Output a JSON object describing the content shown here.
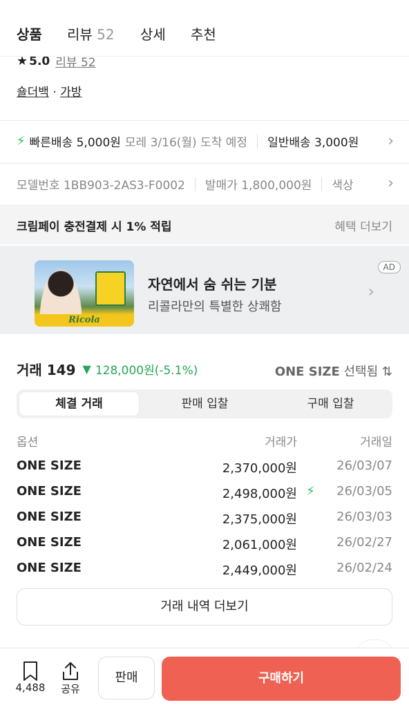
{
  "tabs": [
    {
      "label": "상품",
      "count": ""
    },
    {
      "label": "리뷰",
      "count": "52"
    },
    {
      "label": "상세",
      "count": ""
    },
    {
      "label": "추천",
      "count": ""
    }
  ],
  "rating": {
    "score": "5.0",
    "review_link": "리뷰 52"
  },
  "breadcrumb": {
    "cat1": "숄더백",
    "sep": "·",
    "cat2": "가방"
  },
  "shipping": {
    "fast_label": "빠른배송 5,000원",
    "fast_date": "모레 3/16(월) 도착 예정",
    "normal_label": "일반배송 3,000원"
  },
  "info": {
    "model": "모델번호 1BB903-2AS3-F0002",
    "release_price": "발매가 1,800,000원",
    "color": "색상"
  },
  "point": {
    "text": "크림페이 충전결제 시 1% 적립",
    "more": "혜택 더보기"
  },
  "ad": {
    "brand": "Ricola",
    "title": "자연에서 숨 쉬는 기분",
    "subtitle": "리콜라만의 특별한 상쾌함",
    "badge": "AD"
  },
  "trade": {
    "label": "거래 149",
    "change": "128,000원(-5.1%)",
    "size_value": "ONE SIZE",
    "size_suffix": "선택됨"
  },
  "segments": [
    "체결 거래",
    "판매 입찰",
    "구매 입찰"
  ],
  "table": {
    "headers": [
      "옵션",
      "거래가",
      "거래일"
    ],
    "rows": [
      {
        "option": "ONE SIZE",
        "price": "2,370,000원",
        "date": "26/03/07"
      },
      {
        "option": "ONE SIZE",
        "price": "2,498,000원",
        "date": "26/03/05"
      },
      {
        "option": "ONE SIZE",
        "price": "2,375,000원",
        "date": "26/03/03"
      },
      {
        "option": "ONE SIZE",
        "price": "2,061,000원",
        "date": "26/02/27"
      },
      {
        "option": "ONE SIZE",
        "price": "2,449,000원",
        "date": "26/02/24"
      }
    ]
  },
  "more_button": "거래 내역 더보기",
  "bottom": {
    "bookmark_count": "4,488",
    "share": "공유",
    "sell": "판매",
    "buy": "구매하기"
  },
  "colors": {
    "accent": "#ef6253",
    "green": "#27a55a"
  }
}
